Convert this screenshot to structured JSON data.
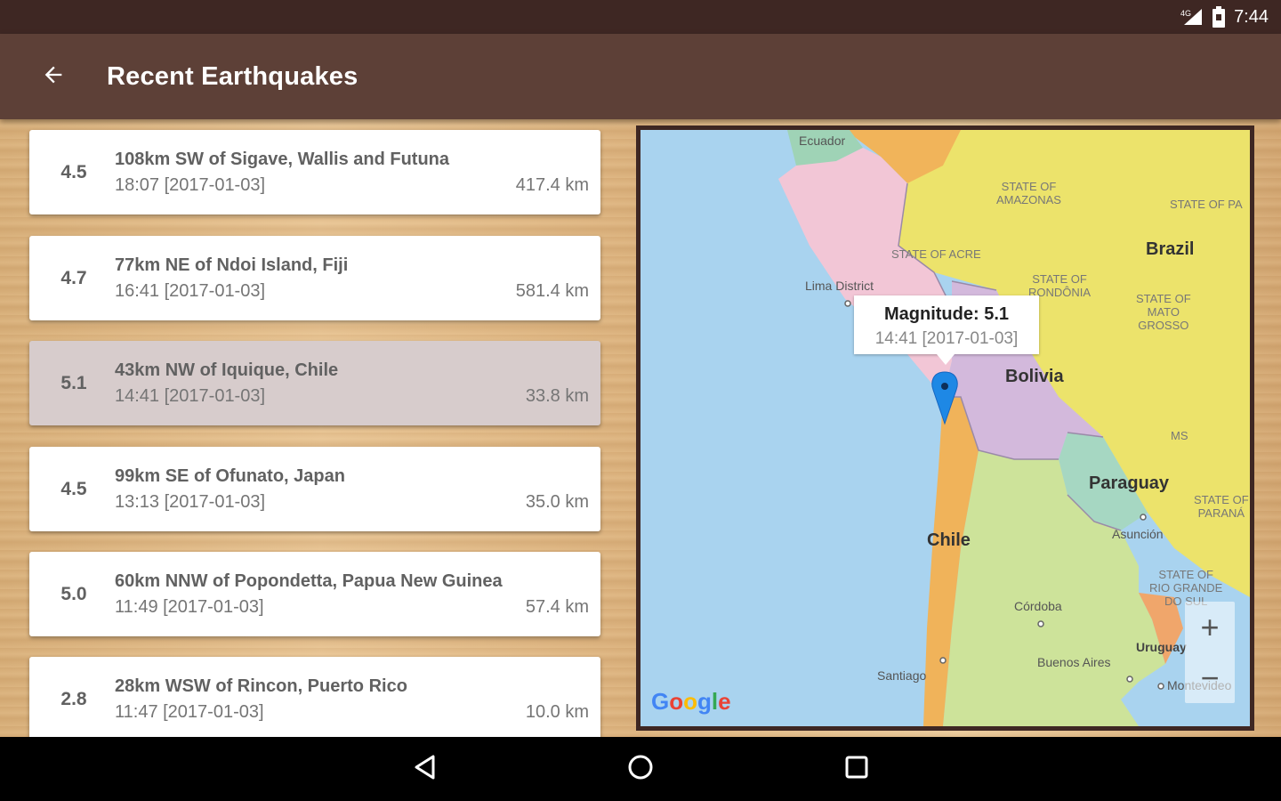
{
  "status_bar": {
    "time": "7:44",
    "icons": [
      "signal-4g-icon",
      "battery-icon"
    ]
  },
  "app_bar": {
    "title": "Recent Earthquakes",
    "back_icon": "arrow-back-icon"
  },
  "quakes": [
    {
      "magnitude": "4.5",
      "place": "108km SW of Sigave, Wallis and Futuna",
      "time": "18:07  [2017-01-03]",
      "distance": "417.4 km",
      "selected": false
    },
    {
      "magnitude": "4.7",
      "place": "77km NE of Ndoi Island, Fiji",
      "time": "16:41  [2017-01-03]",
      "distance": "581.4 km",
      "selected": false
    },
    {
      "magnitude": "5.1",
      "place": "43km NW of Iquique, Chile",
      "time": "14:41  [2017-01-03]",
      "distance": "33.8 km",
      "selected": true
    },
    {
      "magnitude": "4.5",
      "place": "99km SE of Ofunato, Japan",
      "time": "13:13  [2017-01-03]",
      "distance": "35.0 km",
      "selected": false
    },
    {
      "magnitude": "5.0",
      "place": "60km NNW of Popondetta, Papua New Guinea",
      "time": "11:49  [2017-01-03]",
      "distance": "57.4 km",
      "selected": false
    },
    {
      "magnitude": "2.8",
      "place": "28km WSW of Rincon, Puerto Rico",
      "time": "11:47  [2017-01-03]",
      "distance": "10.0 km",
      "selected": false
    }
  ],
  "map": {
    "labels": {
      "ecuador": "Ecuador",
      "state_amazonas": "STATE OF\nAMAZONAS",
      "state_pa": "STATE OF PA",
      "brazil": "Brazil",
      "state_acre": "STATE OF ACRE",
      "lima": "Lima District",
      "state_rondonia": "STATE OF\nRONDÔNIA",
      "state_mato_grosso": "STATE OF\nMATO\nGROSSO",
      "bolivia": "Bolivia",
      "ms": "MS",
      "paraguay": "Paraguay",
      "state_parana": "STATE OF\nPARANÁ",
      "asuncion": "Asunción",
      "chile": "Chile",
      "state_rgs": "STATE OF\nRIO GRANDE\nDO SUL",
      "cordoba": "Córdoba",
      "uruguay": "Uruguay",
      "buenos_aires": "Buenos Aires",
      "santiago": "Santiago",
      "montevideo": "Montevideo"
    },
    "info_window": {
      "title": "Magnitude: 5.1",
      "time": "14:41  [2017-01-03]"
    },
    "zoom_in": "+",
    "zoom_out": "−",
    "attribution": "Google",
    "colors": {
      "ocean": "#a9d3ef",
      "peru": "#f2c6d6",
      "brazil": "#ece36b",
      "bolivia": "#d3b9dc",
      "chile": "#f0b35a",
      "argentina": "#cde39a",
      "paraguay": "#a6d7c2",
      "uruguay": "#f0a66b",
      "colombia": "#f1b45a",
      "ecuador": "#9fd3b6",
      "marker": "#1e88e5"
    }
  },
  "nav_bar": {
    "back": "nav-back-icon",
    "home": "nav-home-icon",
    "recents": "nav-recents-icon"
  }
}
